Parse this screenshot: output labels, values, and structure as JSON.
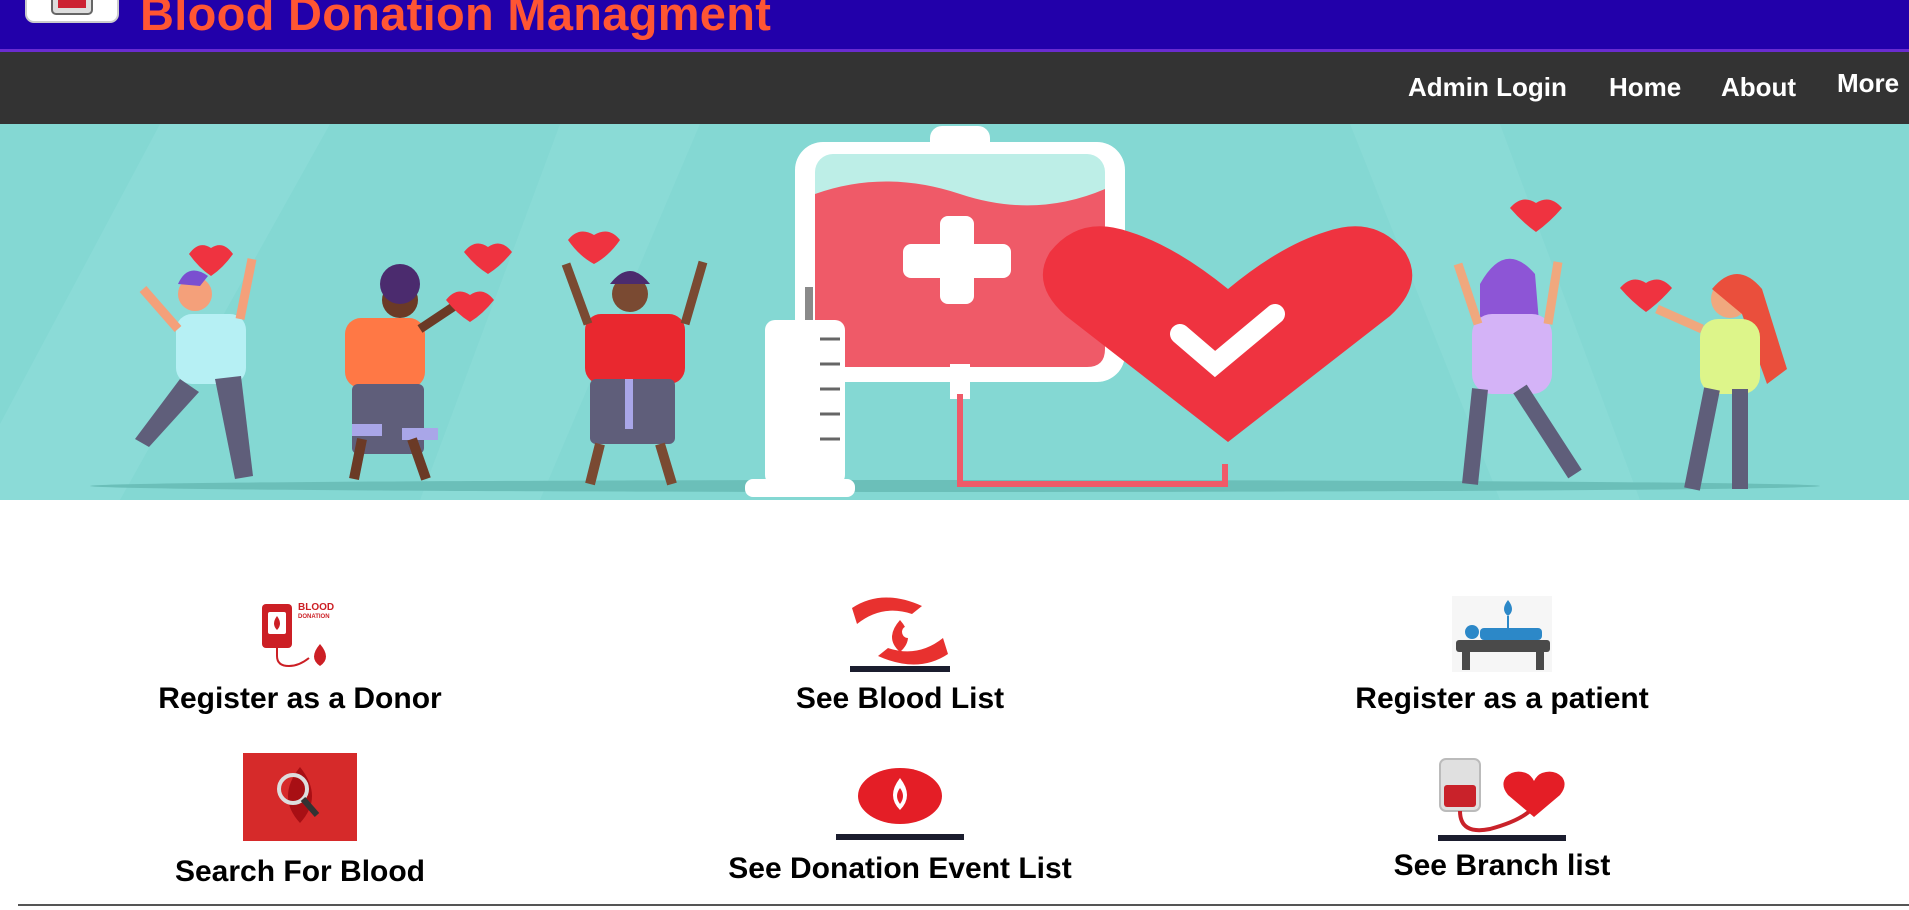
{
  "header": {
    "title": "Blood Donation Managment",
    "logo_icon": "blood-bag-logo-icon",
    "background_color": "#2200aa",
    "title_color": "#ff5533"
  },
  "nav": {
    "items": [
      {
        "label": "Admin Login"
      },
      {
        "label": "Home"
      },
      {
        "label": "About"
      },
      {
        "label": "More"
      }
    ],
    "background_color": "#333333"
  },
  "hero": {
    "illustration": "blood-donation-banner-illustration",
    "background_color": "#84d8d3"
  },
  "features": [
    {
      "label": "Register as a Donor",
      "icon": "blood-donation-bag-icon"
    },
    {
      "label": "See Blood List",
      "icon": "hands-protecting-blood-drop-icon"
    },
    {
      "label": "Register as a patient",
      "icon": "patient-bed-drip-icon"
    },
    {
      "label": "Search For Blood",
      "icon": "magnifier-blood-drop-icon"
    },
    {
      "label": "See Donation Event List",
      "icon": "blood-drop-badge-icon"
    },
    {
      "label": "See Branch list",
      "icon": "blood-bag-heart-icon"
    }
  ]
}
